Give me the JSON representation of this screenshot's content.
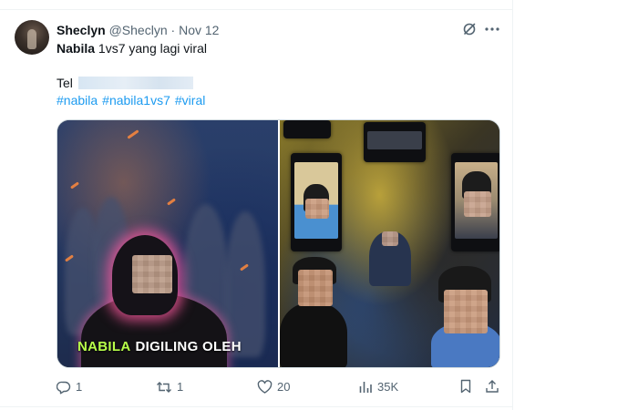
{
  "tweet": {
    "display_name": "Sheclyn",
    "handle": "@Sheclyn",
    "separator": "·",
    "date": "Nov 12",
    "title_bold": "Nabila",
    "title_rest": " 1vs7 yang lagi viral",
    "tel_label": "Tel",
    "hashtags": [
      "#nabila",
      "#nabila1vs7",
      "#viral"
    ]
  },
  "media": {
    "caption_highlight": "NABILA",
    "caption_rest": "DIGILING OLEH",
    "highlight_color": "#b8ff4a",
    "glow_color": "#ff5aa0"
  },
  "actions": {
    "reply_count": "1",
    "retweet_count": "1",
    "like_count": "20",
    "views_count": "35K"
  },
  "colors": {
    "text": "#0f1419",
    "secondary": "#536471",
    "link": "#1d9bf0",
    "border": "#cfd9de"
  },
  "icons": [
    "grok-icon",
    "more-icon",
    "reply-icon",
    "retweet-icon",
    "like-icon",
    "views-icon",
    "bookmark-icon",
    "share-icon"
  ]
}
